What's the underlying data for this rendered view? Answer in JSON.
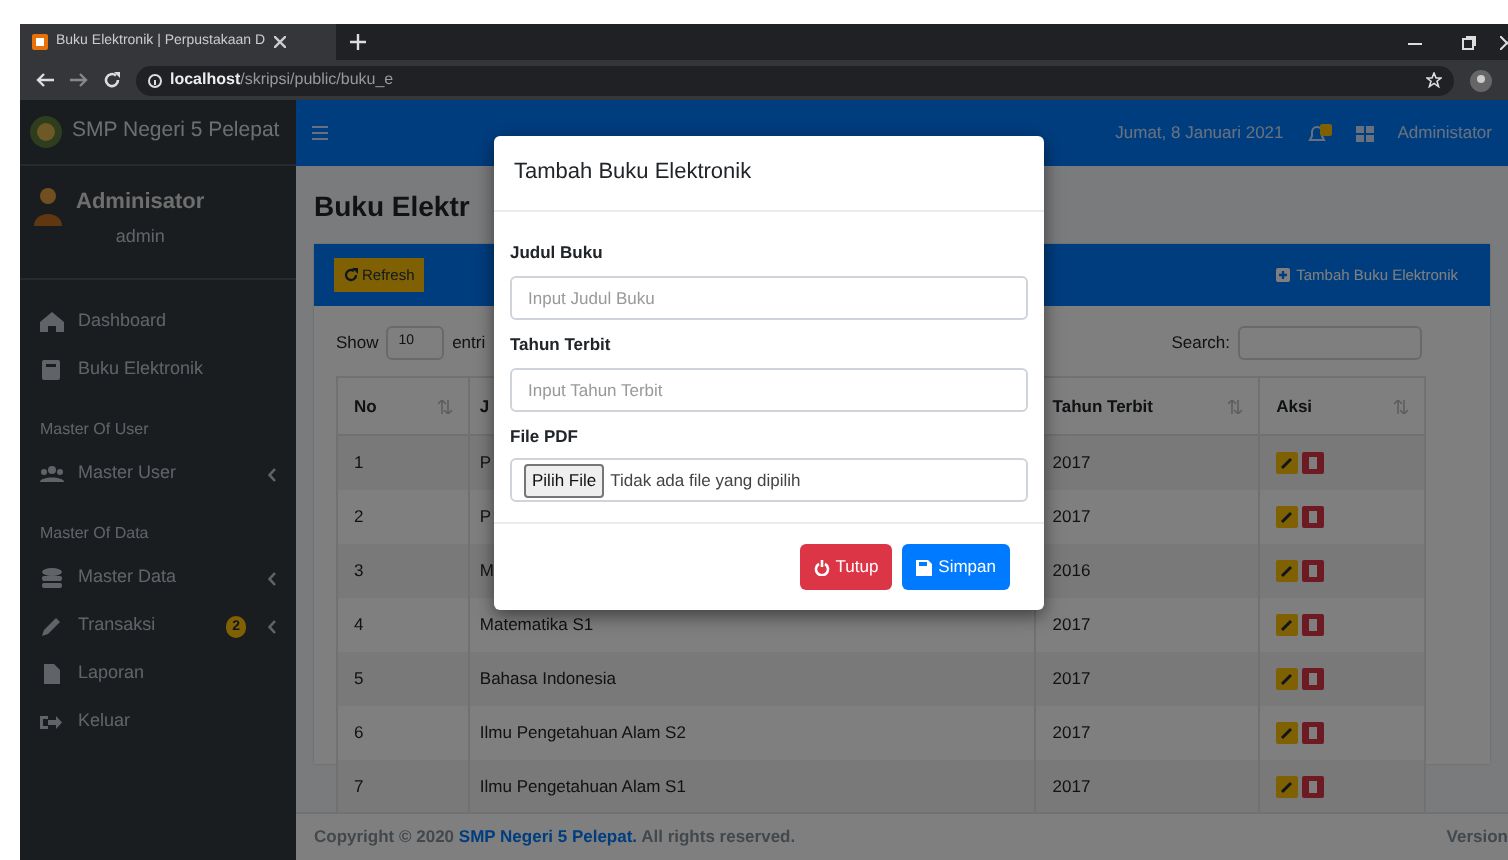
{
  "browser": {
    "tab_title": "Buku Elektronik | Perpustakaan D",
    "address": "**localhost**/skripsi/public/buku_e"
  },
  "navbar": {
    "brand": "SMP Negeri 5 Pelepat",
    "date": "Jumat, 8 Januari 2021",
    "user": "Administator"
  },
  "sidebar": {
    "user_name": "Adminisator",
    "user_role": "admin",
    "items": [
      {
        "kind": "link",
        "label": "Dashboard",
        "submenu": false
      },
      {
        "kind": "link",
        "label": "Buku Elektronik",
        "submenu": false
      },
      {
        "kind": "header",
        "label": "Master Of User"
      },
      {
        "kind": "link",
        "label": "Master User",
        "submenu": true
      },
      {
        "kind": "header",
        "label": "Master Of Data"
      },
      {
        "kind": "link",
        "label": "Master Data",
        "submenu": true
      },
      {
        "kind": "link",
        "label": "Transaksi",
        "submenu": true,
        "badge": "2"
      },
      {
        "kind": "link",
        "label": "Laporan",
        "submenu": false
      },
      {
        "kind": "link",
        "label": "Keluar",
        "submenu": false
      }
    ]
  },
  "page_title": "Buku Elektr",
  "card": {
    "refresh": "Refresh",
    "add": "Tambah Buku Elektronik",
    "show": "Show",
    "length": "10",
    "entries": "entri",
    "search": "Search:"
  },
  "table": {
    "columns": [
      "No",
      "J",
      "Tahun Terbit",
      "Aksi"
    ],
    "rows": [
      {
        "no": "1",
        "title": "P",
        "year": "2017"
      },
      {
        "no": "2",
        "title": "P",
        "year": "2017"
      },
      {
        "no": "3",
        "title": "M",
        "year": "2016"
      },
      {
        "no": "4",
        "title": "Matematika S1",
        "year": "2017"
      },
      {
        "no": "5",
        "title": "Bahasa Indonesia",
        "year": "2017"
      },
      {
        "no": "6",
        "title": "Ilmu Pengetahuan Alam S2",
        "year": "2017"
      },
      {
        "no": "7",
        "title": "Ilmu Pengetahuan Alam S1",
        "year": "2017"
      }
    ]
  },
  "footer": {
    "text": "Copyright © 2020 **SMP Negeri 5 Pelepat.** All rights reserved.",
    "version": "Version"
  },
  "modal": {
    "title": "Tambah Buku Elektronik",
    "fields": [
      {
        "kind": "text",
        "label": "Judul Buku",
        "placeholder": "Input Judul Buku"
      },
      {
        "kind": "text",
        "label": "Tahun Terbit",
        "placeholder": "Input Tahun Terbit"
      },
      {
        "kind": "file",
        "label": "File PDF",
        "button": "Pilih File",
        "value": "Tidak ada file yang dipilih"
      }
    ],
    "buttons": [
      {
        "kind": "danger",
        "label": "Tutup"
      },
      {
        "kind": "primary",
        "label": "Simpan"
      }
    ]
  }
}
